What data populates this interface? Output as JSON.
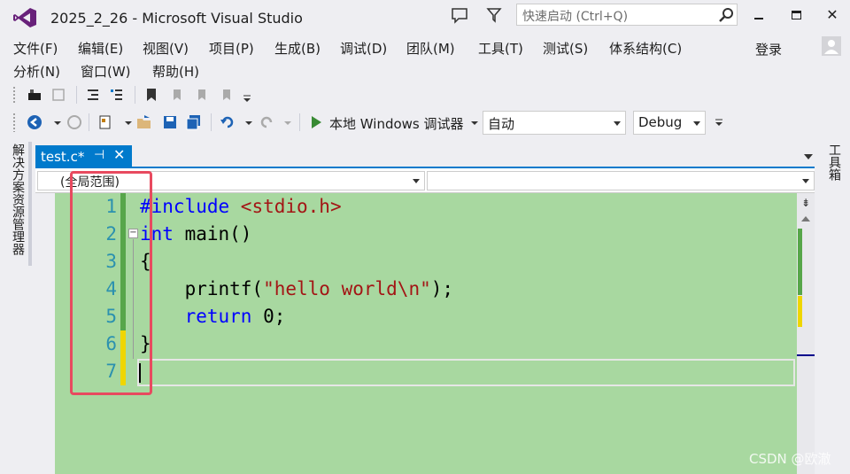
{
  "window": {
    "title": "2025_2_26 - Microsoft Visual Studio",
    "quick_launch_placeholder": "快速启动 (Ctrl+Q)",
    "login": "登录"
  },
  "menu": {
    "row1": [
      "文件(F)",
      "编辑(E)",
      "视图(V)",
      "项目(P)",
      "生成(B)",
      "调试(D)",
      "团队(M)",
      "工具(T)",
      "测试(S)",
      "体系结构(C)"
    ],
    "row2": [
      "分析(N)",
      "窗口(W)",
      "帮助(H)"
    ]
  },
  "toolbar": {
    "run_label": "本地 Windows 调试器",
    "config_combo": "自动",
    "build_combo": "Debug"
  },
  "side_panels": {
    "left": "解决方案资源管理器",
    "right": "工具箱"
  },
  "document": {
    "tab_label": "test.c*",
    "scope": "(全局范围)"
  },
  "editor": {
    "line_numbers": [
      "1",
      "2",
      "3",
      "4",
      "5",
      "6",
      "7"
    ],
    "lines": [
      {
        "pp": "#include",
        "inc": " <stdio.h>"
      },
      {
        "kw": "int",
        "text": " main()"
      },
      {
        "text": "{"
      },
      {
        "indent": "    ",
        "text": "printf(",
        "str": "\"hello world\\n\"",
        "tail": ");"
      },
      {
        "indent": "    ",
        "kw": "return",
        "text": " 0;"
      },
      {
        "text": "}"
      },
      {
        "text": ""
      }
    ]
  },
  "watermark": "CSDN @欧澈",
  "colors": {
    "accent": "#007acc",
    "editor_bg": "#a8d8a0",
    "highlight_box": "#e84a5f",
    "change_saved": "#57a64a",
    "change_unsaved": "#efd600"
  }
}
